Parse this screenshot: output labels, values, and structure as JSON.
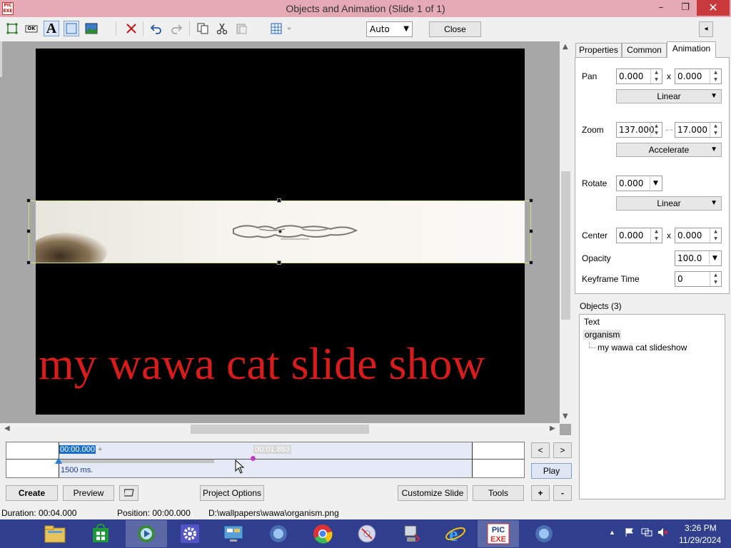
{
  "window": {
    "title": "Objects and Animation  (Slide 1 of 1)",
    "app_icon_text": "PIC EXE",
    "min_glyph": "–",
    "max_glyph": "❐",
    "close_glyph": "✕"
  },
  "toolbar": {
    "zoom_select": "Auto",
    "close_label": "Close",
    "collapse_glyph": "◂",
    "button_glyph": "OK",
    "text_glyph": "A"
  },
  "slide": {
    "caption": "my wawa cat slide show"
  },
  "timeline": {
    "current_time": "00:00.000",
    "marker_time": "00:01.883",
    "duration_label": "1500 ms.",
    "prev_glyph": "<",
    "next_glyph": ">",
    "play_label": "Play",
    "plus_glyph": "+",
    "minus_glyph": "-",
    "start_mark": "+"
  },
  "bottom_buttons": {
    "create": "Create",
    "preview": "Preview",
    "project_options": "Project Options",
    "customize_slide": "Customize Slide",
    "tools": "Tools"
  },
  "status": {
    "duration": "Duration:  00:04.000",
    "position": "Position:  00:00.000",
    "path": "D:\\wallpapers\\wawa\\organism.png"
  },
  "tabs": [
    {
      "label": "Properties"
    },
    {
      "label": "Common"
    },
    {
      "label": "Animation"
    }
  ],
  "animation": {
    "pan_label": "Pan",
    "pan_x": "0.000",
    "pan_y": "0.000",
    "pan_mode": "Linear",
    "zoom_label": "Zoom",
    "zoom_x": "137.000",
    "zoom_y": "17.000",
    "zoom_mode": "Accelerate",
    "rotate_label": "Rotate",
    "rotate_value": "0.000",
    "rotate_mode": "Linear",
    "center_label": "Center",
    "center_x": "0.000",
    "center_y": "0.000",
    "opacity_label": "Opacity",
    "opacity_value": "100.0",
    "keyframe_label": "Keyframe Time",
    "keyframe_value": "0",
    "x_sep": "x"
  },
  "objects": {
    "title": "Objects (3)",
    "items": [
      "Text",
      "organism",
      "my wawa cat slideshow"
    ]
  },
  "tray": {
    "time": "3:26 PM",
    "date": "11/29/2024"
  },
  "colors": {
    "caption_red": "#d81b1b",
    "taskbar": "#2f3f8e",
    "titlebar": "#e4a9b4",
    "selection_blue": "#1b6fc8"
  }
}
